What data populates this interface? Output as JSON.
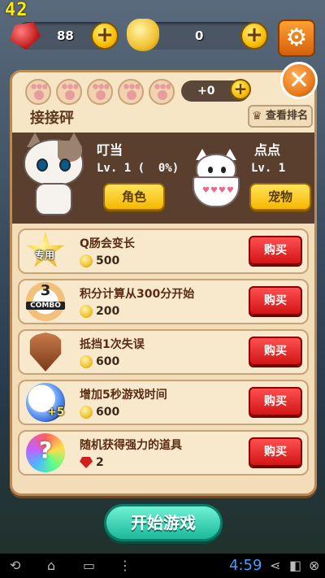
{
  "fps": "42",
  "resources": {
    "gems": "88",
    "coins": "0"
  },
  "panel": {
    "score": "+0",
    "title": "接接砰",
    "rank_label": "查看排名"
  },
  "player": {
    "name": "叮当",
    "level": "Lv. 1 (  0%)",
    "role_button": "角色"
  },
  "pet": {
    "name": "点点",
    "level": "Lv. 1",
    "pet_button": "宠物"
  },
  "shop": {
    "buy_label": "购买",
    "items": [
      {
        "icon_label": "专用",
        "name": "Q肠会变长",
        "price": "500",
        "currency": "coin"
      },
      {
        "icon_label": "3",
        "icon_sub": "COMBO",
        "name": "积分计算从300分开始",
        "price": "200",
        "currency": "coin"
      },
      {
        "name": "抵挡1次失误",
        "price": "600",
        "currency": "coin"
      },
      {
        "icon_label": "+5",
        "name": "增加5秒游戏时间",
        "price": "600",
        "currency": "coin"
      },
      {
        "icon_label": "?",
        "name": "随机获得强力的道具",
        "price": "2",
        "currency": "gem"
      }
    ]
  },
  "start_button": "开始游戏",
  "system": {
    "time": "4:59"
  },
  "icons": {
    "settings": "gear-icon",
    "close": "close-icon",
    "rank": "crown-icon",
    "back": "back-icon",
    "home": "home-icon",
    "recents": "recents-icon"
  }
}
